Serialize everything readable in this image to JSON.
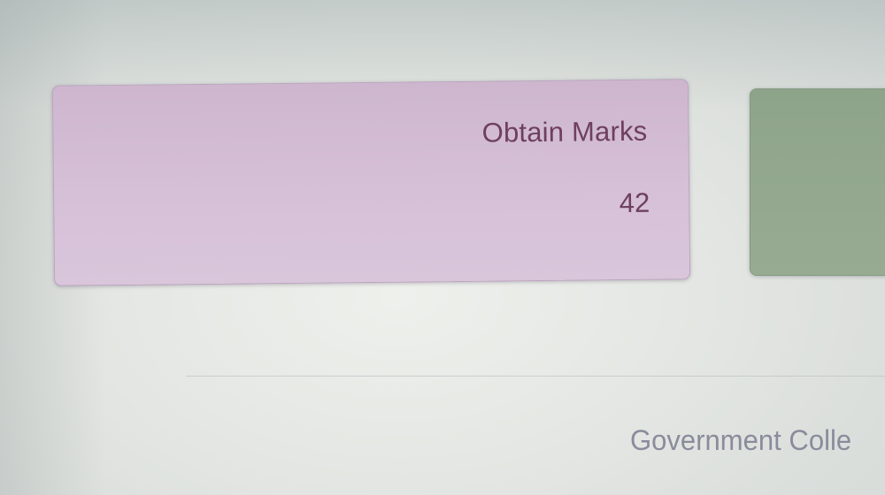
{
  "stats": {
    "obtain_marks": {
      "label": "Obtain Marks",
      "value": "42",
      "color": "#d3bdd5"
    },
    "next_card": {
      "color": "#93a88f"
    }
  },
  "footer": {
    "text": "Government Colle"
  }
}
